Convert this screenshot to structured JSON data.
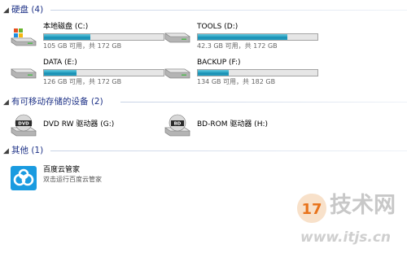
{
  "groups": {
    "hard_disks": {
      "title": "硬盘 (4)",
      "drives": [
        {
          "name": "本地磁盘 (C:)",
          "space": "105 GB 可用，共 172 GB",
          "fill": 0.39
        },
        {
          "name": "TOOLS (D:)",
          "space": "42.3 GB 可用，共 172 GB",
          "fill": 0.75
        },
        {
          "name": "DATA (E:)",
          "space": "126 GB 可用，共 172 GB",
          "fill": 0.27
        },
        {
          "name": "BACKUP (F:)",
          "space": "134 GB 可用，共 182 GB",
          "fill": 0.26
        }
      ]
    },
    "removable": {
      "title": "有可移动存储的设备 (2)",
      "devices": [
        {
          "name": "DVD RW 驱动器 (G:)",
          "disc_label": "DVD"
        },
        {
          "name": "BD-ROM 驱动器 (H:)",
          "disc_label": "BD"
        }
      ]
    },
    "other": {
      "title": "其他 (1)",
      "items": [
        {
          "name": "百度云管家",
          "subtitle": "双击运行百度云管家"
        }
      ]
    }
  },
  "watermark": {
    "logo_text": "17",
    "brand": "技术网",
    "url": "www.itjs.cn"
  },
  "colors": {
    "header_text": "#1e3287",
    "usage_fill": "#2aa5c5",
    "app_icon_bg": "#1a9be0",
    "watermark_orange": "#e8731c"
  }
}
